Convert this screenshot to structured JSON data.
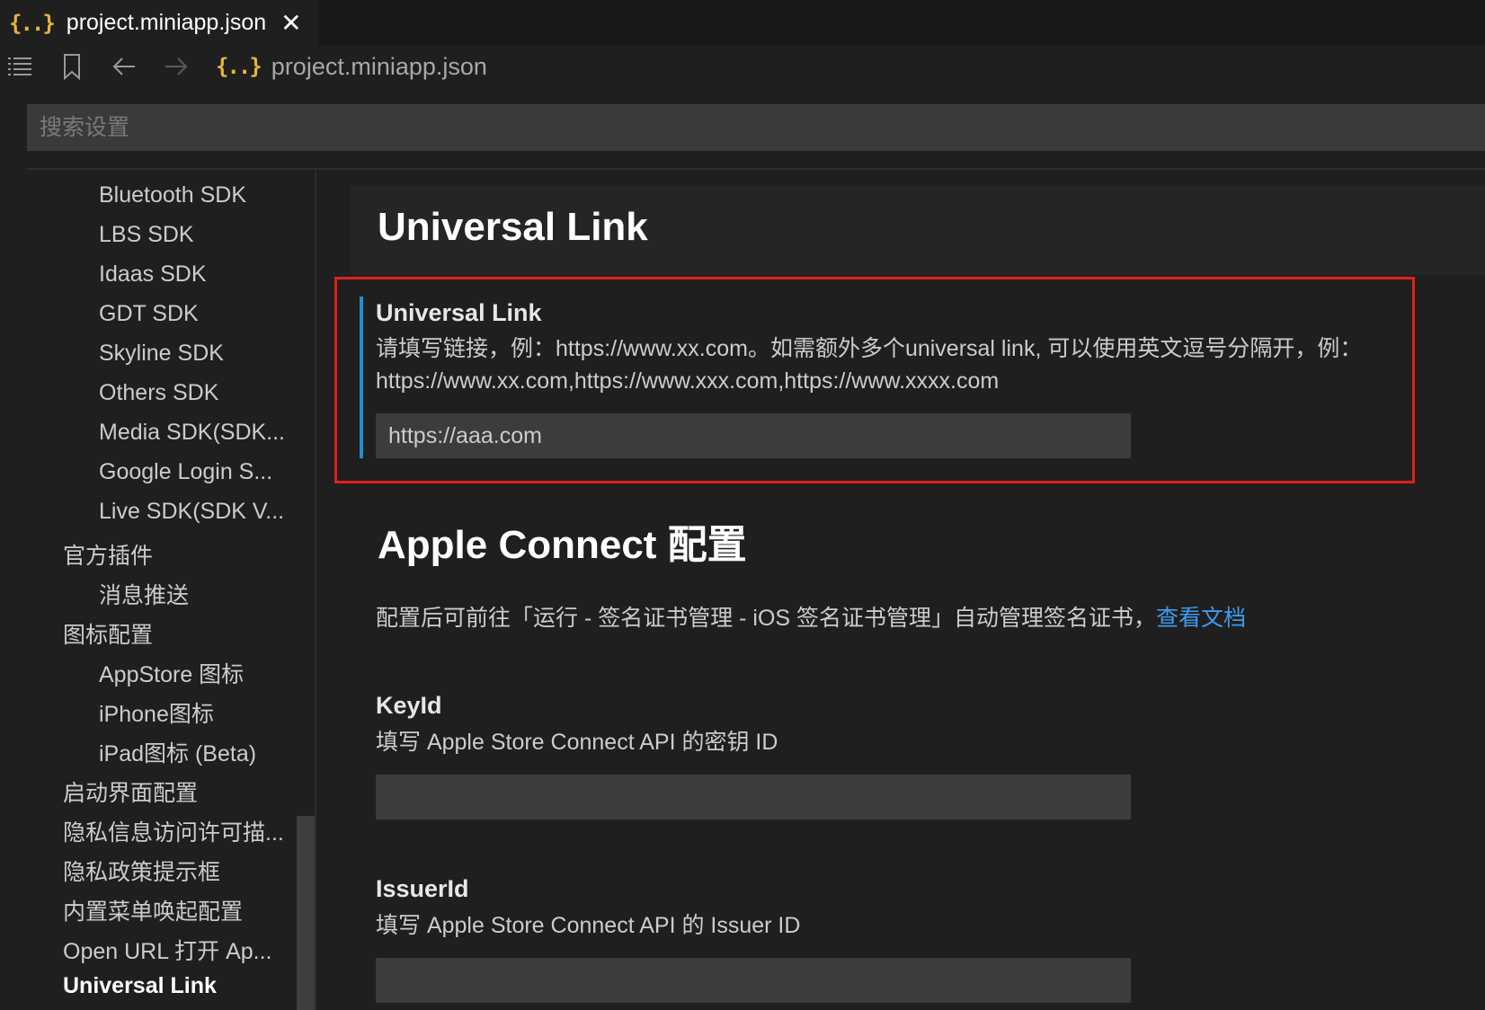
{
  "tab": {
    "icon": "json-braces-icon",
    "title": "project.miniapp.json",
    "close": "✕"
  },
  "toolbar": {
    "breadcrumb_icon": "json-braces-icon",
    "breadcrumb": "project.miniapp.json"
  },
  "search": {
    "placeholder": "搜索设置",
    "value": ""
  },
  "sidebar": {
    "items": [
      {
        "label": "Bluetooth SDK",
        "level": 2
      },
      {
        "label": "LBS SDK",
        "level": 2
      },
      {
        "label": "Idaas SDK",
        "level": 2
      },
      {
        "label": "GDT SDK",
        "level": 2
      },
      {
        "label": "Skyline SDK",
        "level": 2
      },
      {
        "label": "Others SDK",
        "level": 2
      },
      {
        "label": "Media SDK(SDK...",
        "level": 2
      },
      {
        "label": "Google Login S...",
        "level": 2
      },
      {
        "label": "Live SDK(SDK V...",
        "level": 2
      },
      {
        "label": "官方插件",
        "level": 1
      },
      {
        "label": "消息推送",
        "level": 2
      },
      {
        "label": "图标配置",
        "level": 1
      },
      {
        "label": "AppStore 图标",
        "level": 2
      },
      {
        "label": "iPhone图标",
        "level": 2
      },
      {
        "label": "iPad图标 (Beta)",
        "level": 2
      },
      {
        "label": "启动界面配置",
        "level": 1
      },
      {
        "label": "隐私信息访问许可描...",
        "level": 1
      },
      {
        "label": "隐私政策提示框",
        "level": 1
      },
      {
        "label": "内置菜单唤起配置",
        "level": 1
      },
      {
        "label": "Open URL 打开 Ap...",
        "level": 1
      },
      {
        "label": "Universal Link",
        "level": 1,
        "active": true
      }
    ]
  },
  "main": {
    "section1_title": "Universal Link",
    "universal_link": {
      "title": "Universal Link",
      "desc_line1": "请填写链接，例：https://www.xx.com。如需额外多个universal link, 可以使用英文逗号分隔开，例：",
      "desc_line2": "https://www.xx.com,https://www.xxx.com,https://www.xxxx.com",
      "value": "https://aaa.com"
    },
    "section2_title": "Apple Connect 配置",
    "section2_desc": "配置后可前往「运行 - 签名证书管理 - iOS 签名证书管理」自动管理签名证书，",
    "section2_link": "查看文档",
    "keyid": {
      "title": "KeyId",
      "desc": "填写 Apple Store Connect API 的密钥 ID",
      "value": ""
    },
    "issuerid": {
      "title": "IssuerId",
      "desc": "填写 Apple Store Connect API 的 Issuer ID",
      "value": ""
    }
  },
  "colors": {
    "accent_link": "#3b9cf0",
    "highlight_border": "#e0201c",
    "focus_bar": "#1e8fcc",
    "json_icon": "#e8b53c"
  }
}
